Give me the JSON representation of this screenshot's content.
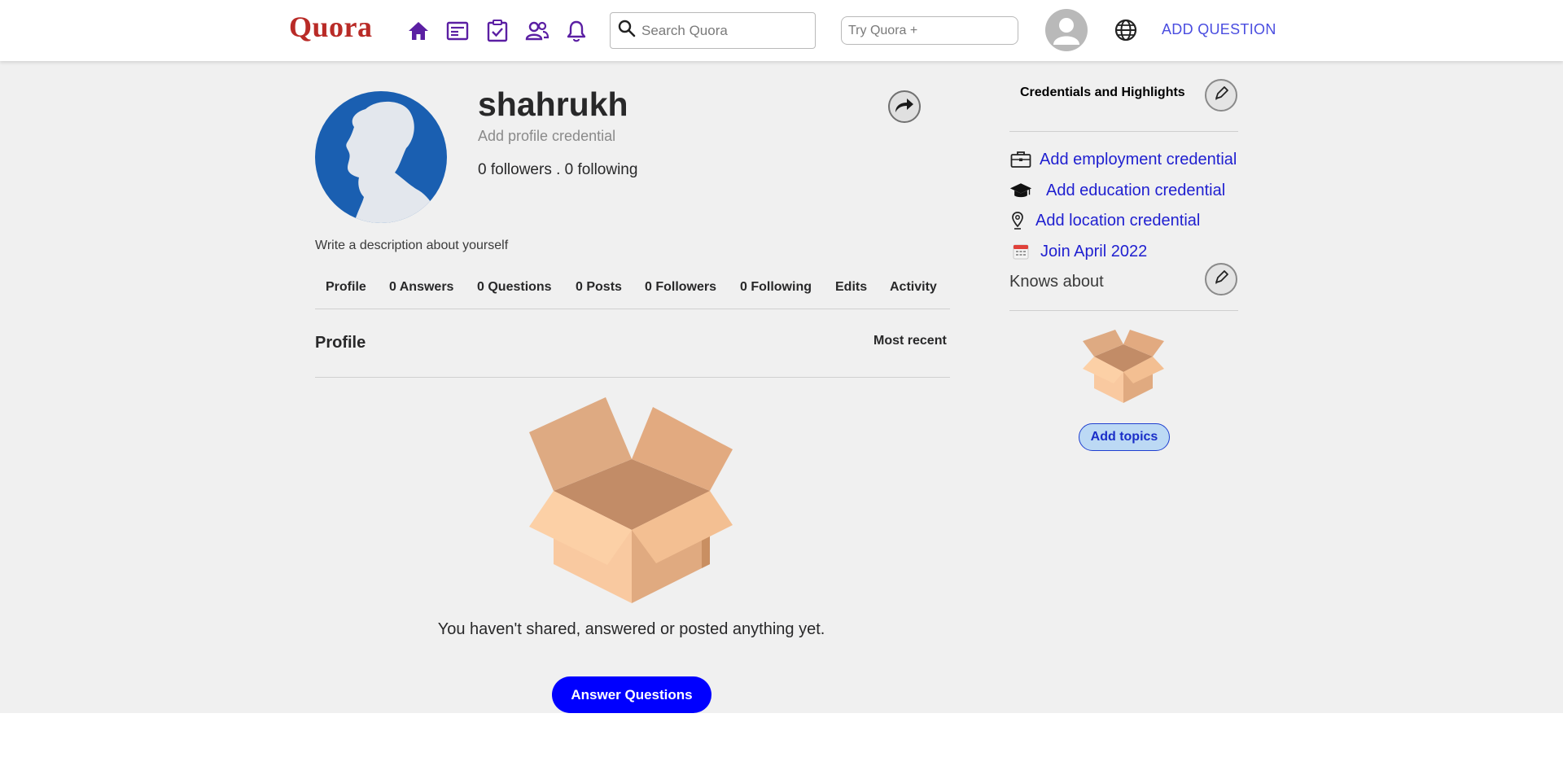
{
  "header": {
    "logo": "Quora",
    "nav_icons": [
      "home-icon",
      "following-icon",
      "answer-icon",
      "spaces-icon",
      "notifications-icon"
    ],
    "search_placeholder": "Search Quora",
    "try_placeholder": "Try Quora +",
    "add_question": "ADD QUESTION",
    "colors": {
      "logo": "#b92b27",
      "nav": "#5b1fa3",
      "link": "#4a4de0"
    }
  },
  "profile": {
    "username": "shahrukh",
    "credential_prompt": "Add profile credential",
    "follow_stats": "0 followers . 0 following",
    "description_prompt": "Write a description about yourself"
  },
  "tabs": [
    "Profile",
    "0 Answers",
    "0 Questions",
    "0 Posts",
    "0 Followers",
    "0 Following",
    "Edits",
    "Activity"
  ],
  "content": {
    "section_title": "Profile",
    "sort_label": "Most recent",
    "empty_message": "You haven't shared, answered or posted anything yet.",
    "answer_button": "Answer Questions"
  },
  "sidebar": {
    "title": "Credentials and Highlights",
    "credentials": [
      {
        "icon": "briefcase-icon",
        "label": "Add employment credential"
      },
      {
        "icon": "graduation-cap-icon",
        "label": "Add education credential"
      },
      {
        "icon": "location-pin-icon",
        "label": "Add location credential"
      },
      {
        "icon": "calendar-icon",
        "label": "Join April 2022"
      }
    ],
    "knows_about": "Knows about",
    "add_topics": "Add topics"
  }
}
